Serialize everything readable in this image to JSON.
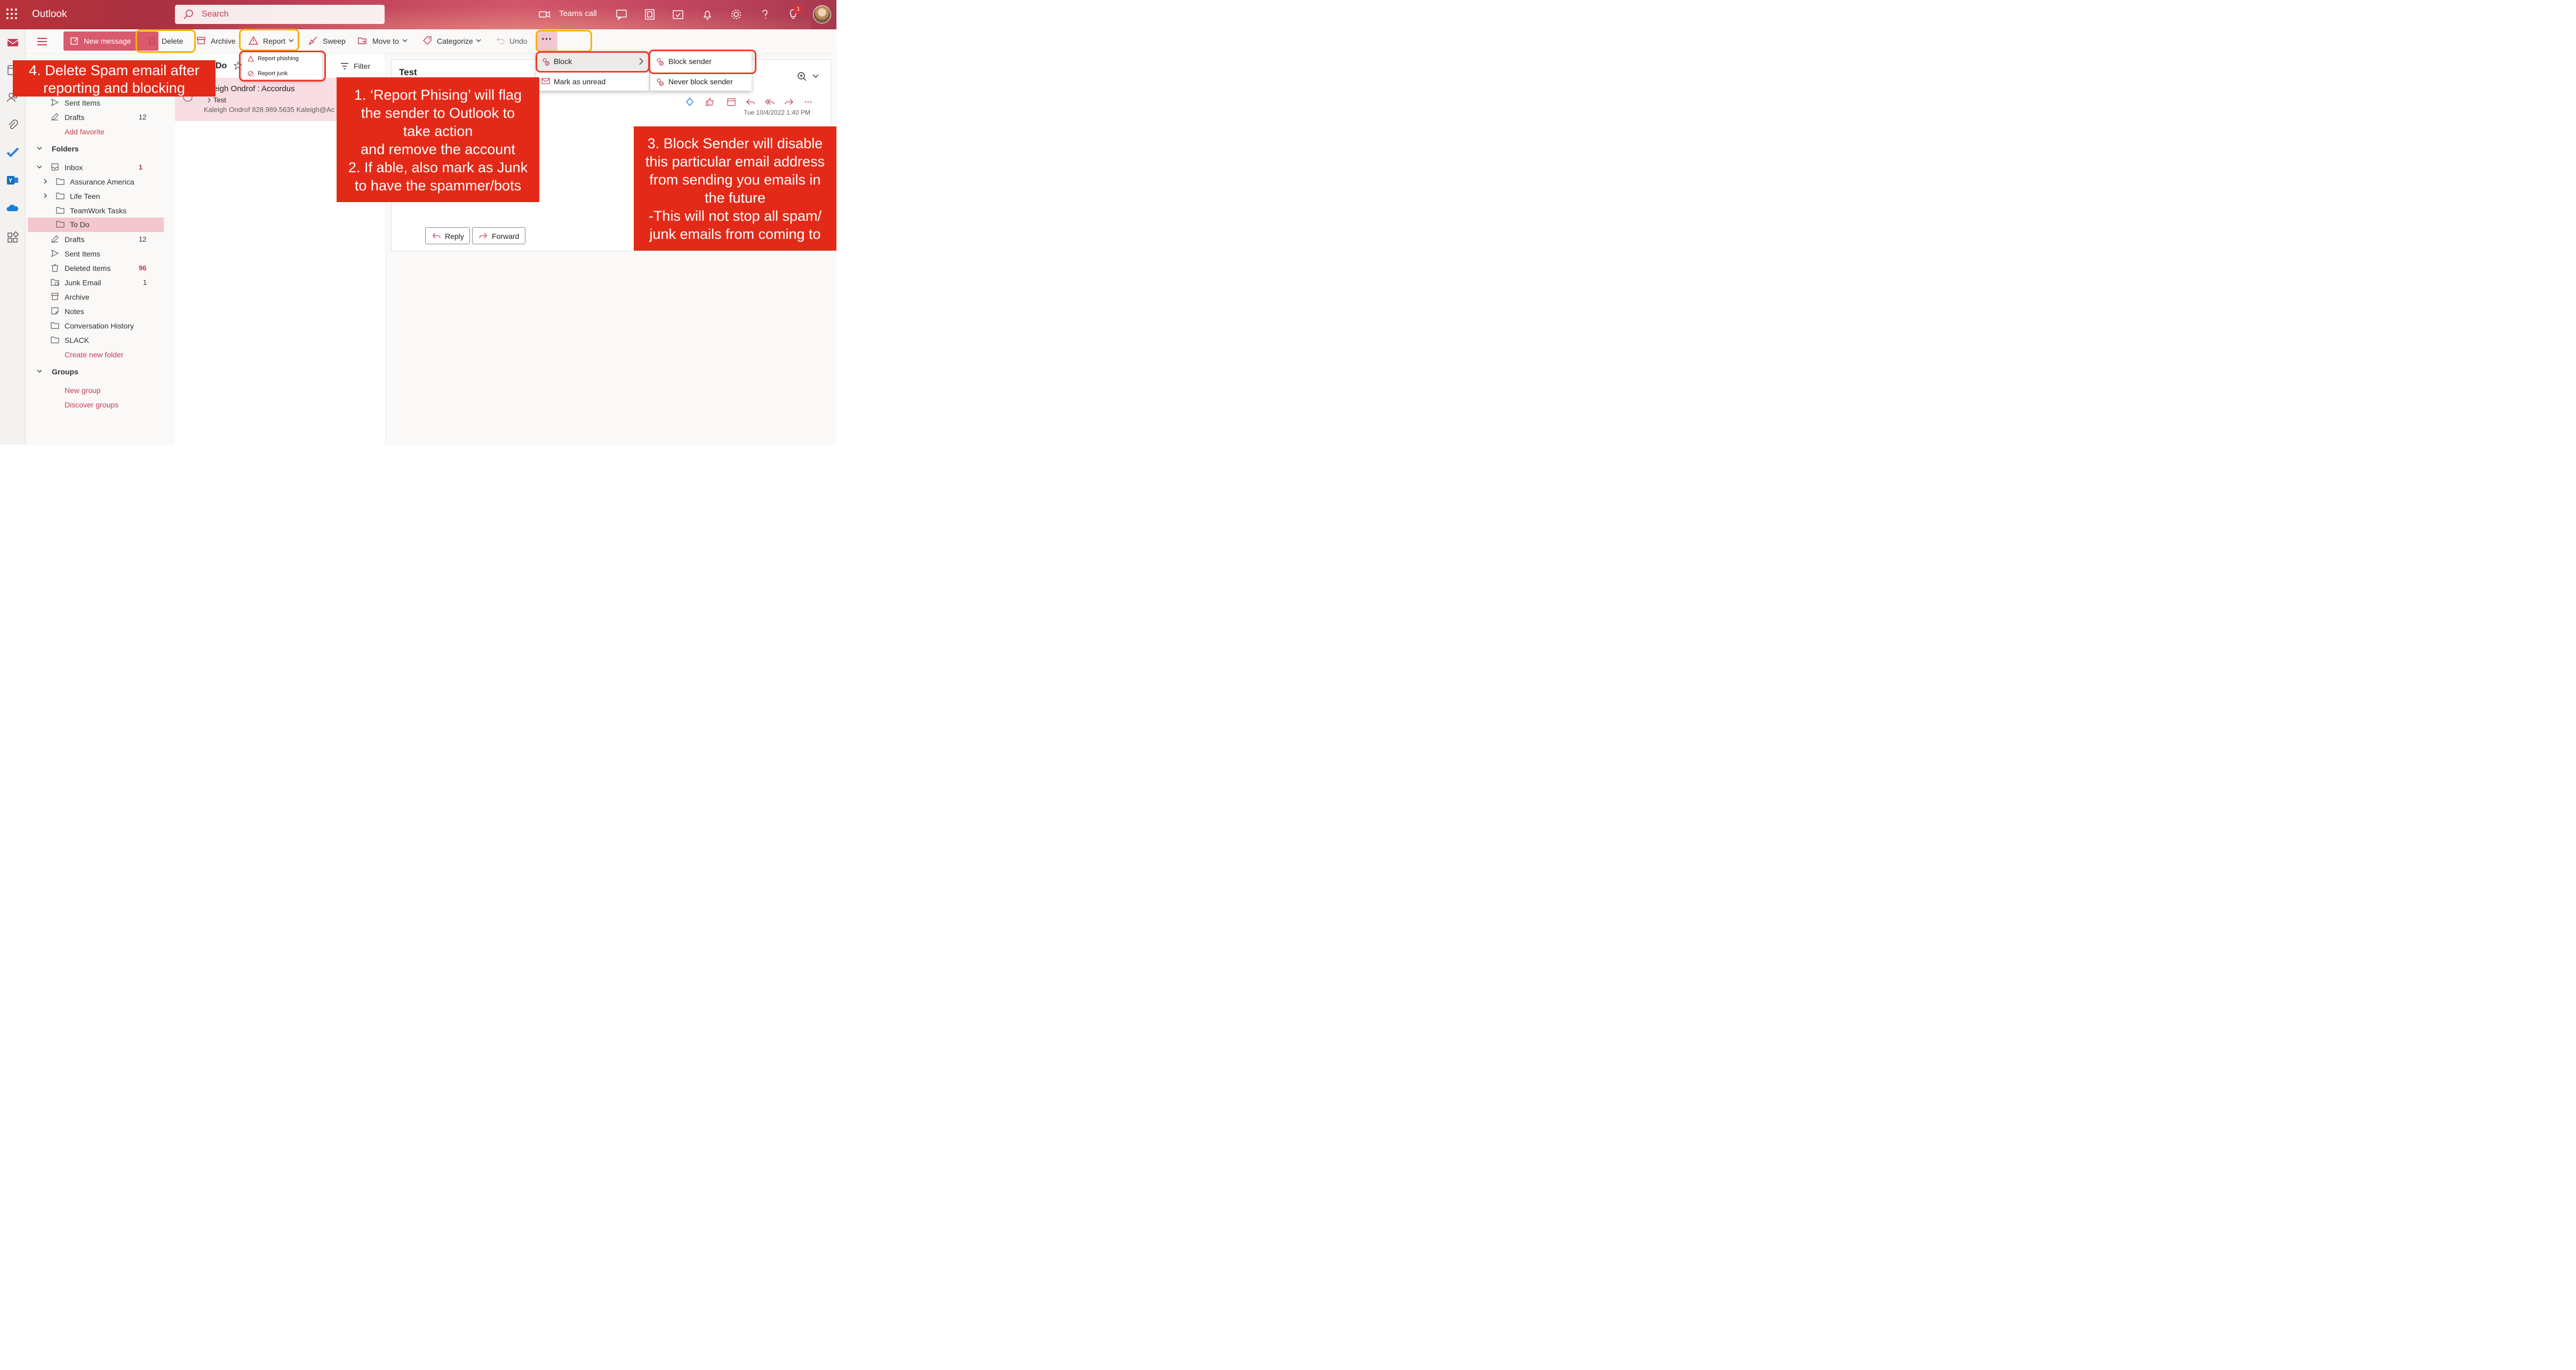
{
  "topbar": {
    "brand": "Outlook",
    "search_placeholder": "Search",
    "teams_call_label": "Teams call",
    "notifications_badge": "1"
  },
  "commands": {
    "new_message": "New message",
    "delete": "Delete",
    "archive": "Archive",
    "report": "Report",
    "sweep": "Sweep",
    "move_to": "Move to",
    "categorize": "Categorize",
    "undo": "Undo",
    "more": "···"
  },
  "report_menu": {
    "phishing": "Report phishing",
    "junk": "Report junk"
  },
  "more_menu": {
    "block": "Block",
    "mark_unread": "Mark as unread"
  },
  "block_submenu": {
    "block_sender": "Block sender",
    "never_block_sender": "Never block sender"
  },
  "folders": {
    "favorites": [
      {
        "label": "Sent Items"
      },
      {
        "label": "Drafts",
        "count": "12"
      },
      {
        "label": "Add favorite"
      }
    ],
    "folders_header": "Folders",
    "inbox": {
      "label": "Inbox",
      "count": "1"
    },
    "inbox_children": [
      {
        "label": "Assurance America"
      },
      {
        "label": "Life Teen"
      },
      {
        "label": "TeamWork Tasks"
      },
      {
        "label": "To Do"
      }
    ],
    "others": [
      {
        "label": "Drafts",
        "count": "12"
      },
      {
        "label": "Sent Items"
      },
      {
        "label": "Deleted Items",
        "count": "96"
      },
      {
        "label": "Junk Email",
        "count": "1"
      },
      {
        "label": "Archive"
      },
      {
        "label": "Notes"
      },
      {
        "label": "Conversation History"
      },
      {
        "label": "SLACK"
      }
    ],
    "create_new_folder": "Create new folder",
    "groups_header": "Groups",
    "new_group": "New group",
    "discover_groups": "Discover groups"
  },
  "message_list": {
    "title": "Do",
    "filter": "Filter",
    "message": {
      "from": "eigh Ondrof : Accordus",
      "subject": "Test",
      "preview": "Kaleigh Ondrof 828.989.5635 Kaleigh@Ac"
    }
  },
  "reading_pane": {
    "subject": "Test",
    "date": "Tue 10/4/2022 1:40 PM",
    "reply": "Reply",
    "forward": "Forward"
  },
  "annotations": {
    "step4": [
      "4. Delete Spam email after",
      "reporting and blocking"
    ],
    "step1_2": [
      "1. ‘Report Phising’ will flag",
      "the sender to Outlook to",
      "take action",
      "and remove the account",
      "2. If able, also mark as Junk",
      "to have the spammer/bots"
    ],
    "step3": [
      "3. Block Sender will disable",
      "this particular email address",
      "from sending you emails in",
      "the future",
      "-This will not stop all spam/",
      "junk emails from coming to"
    ]
  },
  "colors": {
    "accent": "#c43e53",
    "callout": "#e32a18",
    "highlight_ring": "#f7b100",
    "menu_ring": "#ee3b2e"
  }
}
